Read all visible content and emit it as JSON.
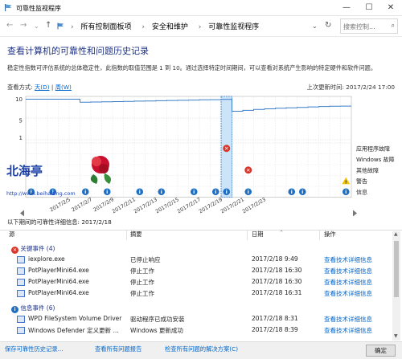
{
  "window": {
    "title": "可靠性监视程序"
  },
  "address": {
    "breadcrumb": [
      "所有控制面板项",
      "安全和维护",
      "可靠性监视程序"
    ],
    "search_placeholder": "搜索控制..."
  },
  "page": {
    "heading": "查看计算机的可靠性和问题历史记录",
    "description": "稳定性指数可评估系统的总体稳定性，此指数的取值范围是 1 到 10。通过选择特定时间期间，可以查看对系统产生影响的特定硬件和软件问题。",
    "view_label": "查看方式:",
    "view_days": "天(D)",
    "view_separator": " | ",
    "view_weeks": "周(W)",
    "last_updated": "上次更新时间: 2017/2/24 17:00",
    "details_title": "以下期间的可靠性详细信息: 2017/2/18"
  },
  "chart_data": {
    "type": "line",
    "y_ticks": [
      "10",
      "5",
      "1"
    ],
    "ylim": [
      1,
      10
    ],
    "x_tick_labels": [
      "2017/2/5",
      "2017/2/7",
      "2017/2/9",
      "2017/2/11",
      "2017/2/13",
      "2017/2/15",
      "2017/2/17",
      "2017/2/19",
      "2017/2/21",
      "2017/2/23"
    ],
    "stability_index": [
      9.9,
      9.9,
      9.9,
      9.9,
      9.9,
      9.2,
      9.25,
      9.3,
      9.35,
      9.4,
      9.45,
      9.5,
      9.55,
      9.6,
      9.65,
      9.7,
      9.75,
      9.8,
      9.85,
      7.1,
      7.3,
      7.5,
      7.65,
      7.8,
      7.9,
      8.0,
      8.1,
      8.2,
      8.25,
      8.3
    ],
    "selected_column": 18,
    "rows": [
      "应用程序故障",
      "Windows 故障",
      "其他故障",
      "警告",
      "信息"
    ],
    "app_failure_columns": [
      18
    ],
    "other_failure_columns": [
      20
    ],
    "warning_columns": [
      29
    ],
    "info_columns": [
      0,
      2,
      5,
      7,
      10,
      12,
      15,
      17,
      18,
      20,
      24,
      25,
      29
    ],
    "watermark": "北海亭",
    "watermark_url": "http://www.beihaiting.com"
  },
  "table": {
    "columns": [
      "源",
      "摘要",
      "日期",
      "操作"
    ],
    "groups": [
      {
        "title": "关键事件 (4)",
        "icon": "critical-icon",
        "rows": [
          {
            "source": "iexplore.exe",
            "summary": "已停止响应",
            "date": "2017/2/18 9:49",
            "action": "查看技术详细信息"
          },
          {
            "source": "PotPlayerMini64.exe",
            "summary": "停止工作",
            "date": "2017/2/18 16:30",
            "action": "查看技术详细信息"
          },
          {
            "source": "PotPlayerMini64.exe",
            "summary": "停止工作",
            "date": "2017/2/18 16:30",
            "action": "查看技术详细信息"
          },
          {
            "source": "PotPlayerMini64.exe",
            "summary": "停止工作",
            "date": "2017/2/18 16:31",
            "action": "查看技术详细信息"
          }
        ]
      },
      {
        "title": "信息事件 (6)",
        "icon": "info-icon",
        "rows": [
          {
            "source": "WPD FileSystem Volume Driver",
            "summary": "驱动程序已成功安装",
            "date": "2017/2/18 8:31",
            "action": "查看技术详细信息"
          },
          {
            "source": "Windows Defender 定义更新 ...",
            "summary": "Windows 更新成功",
            "date": "2017/2/18 8:39",
            "action": "查看技术详细信息"
          }
        ]
      }
    ]
  },
  "footer": {
    "save_history": "保存可靠性历史记录...",
    "view_all_reports": "查看所有问题报告",
    "check_solutions": "检查所有问题的解决方案(C)",
    "ok": "确定"
  },
  "colors": {
    "accent": "#0066cc",
    "heading": "#1e3287",
    "line": "#3a7dc9",
    "error": "#d9362b",
    "warning": "#f2c200",
    "info": "#1f6fc5",
    "selected": "#cce4f7"
  }
}
